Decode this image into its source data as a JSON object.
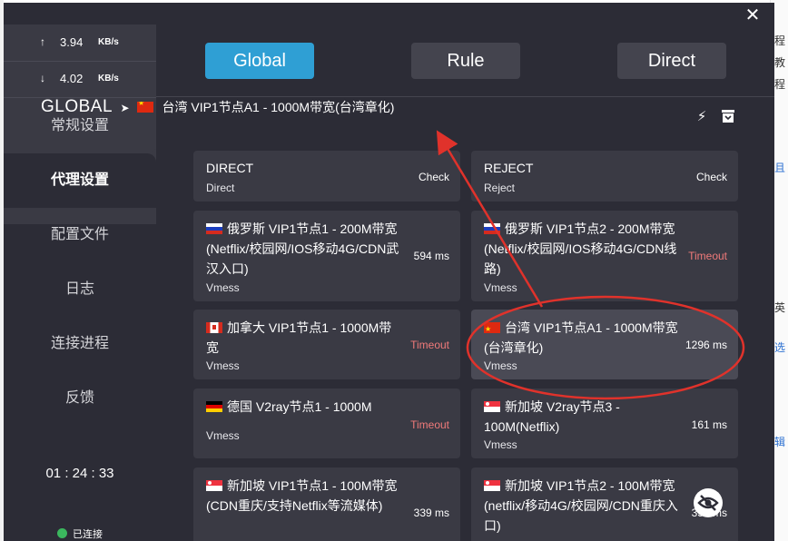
{
  "background": {
    "right_texts": [
      "程",
      "教",
      "程",
      "且",
      "英",
      "选",
      "辑"
    ]
  },
  "sidebar": {
    "upload": {
      "arrow": "↑",
      "value": "3.94",
      "unit": "KB/s"
    },
    "download": {
      "arrow": "↓",
      "value": "4.02",
      "unit": "KB/s"
    },
    "items": [
      {
        "label": "常规设置"
      },
      {
        "label": "代理设置"
      },
      {
        "label": "配置文件"
      },
      {
        "label": "日志"
      },
      {
        "label": "连接进程"
      },
      {
        "label": "反馈"
      }
    ],
    "timer": "01 : 24 : 33",
    "status": "已连接"
  },
  "modes": {
    "global": "Global",
    "rule": "Rule",
    "direct": "Direct"
  },
  "header": {
    "group": "GLOBAL",
    "arrow": "➤",
    "selected": "台湾 VIP1节点A1 - 1000M带宽(台湾章化)"
  },
  "proxies": [
    {
      "title": "DIRECT",
      "type": "Direct",
      "latency": "Check"
    },
    {
      "title": "REJECT",
      "type": "Reject",
      "latency": "Check"
    },
    {
      "title": "俄罗斯 VIP1节点1 - 200M带宽(Netflix/校园网/IOS移动4G/CDN武汉入口)",
      "type": "Vmess",
      "latency": "594 ms"
    },
    {
      "title": "俄罗斯 VIP1节点2 - 200M带宽(Netflix/校园网/IOS移动4G/CDN线路)",
      "type": "Vmess",
      "latency": "Timeout"
    },
    {
      "title": "加拿大 VIP1节点1 - 1000M带宽",
      "type": "Vmess",
      "latency": "Timeout"
    },
    {
      "title": "台湾 VIP1节点A1 - 1000M带宽(台湾章化)",
      "type": "Vmess",
      "latency": "1296 ms"
    },
    {
      "title": "德国 V2ray节点1 - 1000M",
      "type": "Vmess",
      "latency": "Timeout"
    },
    {
      "title": "新加坡 V2ray节点3 - 100M(Netflix)",
      "type": "Vmess",
      "latency": "161 ms"
    },
    {
      "title": "新加坡 VIP1节点1 - 100M带宽(CDN重庆/支持Netflix等流媒体)",
      "type": "",
      "latency": "339 ms"
    },
    {
      "title": "新加坡 VIP1节点2 - 100M带宽(netflix/移动4G/校园网/CDN重庆入口)",
      "type": "",
      "latency": "359 ms"
    }
  ],
  "colors": {
    "accent": "#2f9fd4",
    "timeout": "#f07a7a",
    "annotation": "#e0322b",
    "connected": "#3bb75e"
  }
}
